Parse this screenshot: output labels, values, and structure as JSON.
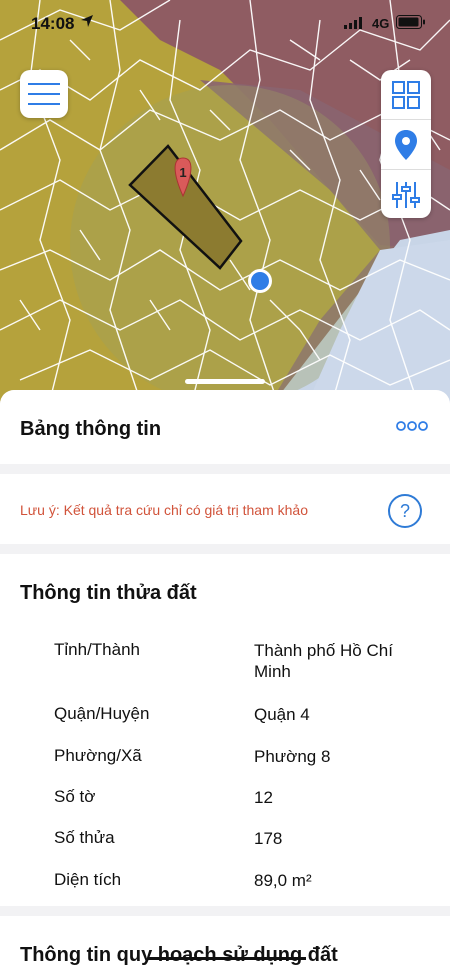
{
  "status_bar": {
    "time": "14:08",
    "network": "4G"
  },
  "map": {
    "marker_label": "1",
    "colors": {
      "plum_zone": "#8e5a62",
      "olive_zone": "#b3a13c",
      "blue_zone": "#c7d4e6",
      "parcel_fill": "#8c7b30"
    }
  },
  "controls": {
    "menu_icon": "hamburger-icon",
    "tool_icons": [
      "grid-icon",
      "location-pin-icon",
      "sliders-icon"
    ]
  },
  "info_panel": {
    "title": "Bảng thông tin",
    "note": "Lưu ý: Kết quả tra cứu chỉ có giá trị tham khảo",
    "help": "?"
  },
  "parcel_info": {
    "title": "Thông tin thửa đất",
    "rows": [
      {
        "label": "Tỉnh/Thành",
        "value": "Thành phố Hồ Chí Minh"
      },
      {
        "label": "Quận/Huyện",
        "value": "Quận 4"
      },
      {
        "label": "Phường/Xã",
        "value": "Phường 8"
      },
      {
        "label": "Số tờ",
        "value": "12"
      },
      {
        "label": "Số thửa",
        "value": "178"
      },
      {
        "label": "Diện tích",
        "value": "89,0 m²"
      }
    ]
  },
  "planning_info": {
    "title": "Thông tin quy hoạch sử dụng đất"
  }
}
